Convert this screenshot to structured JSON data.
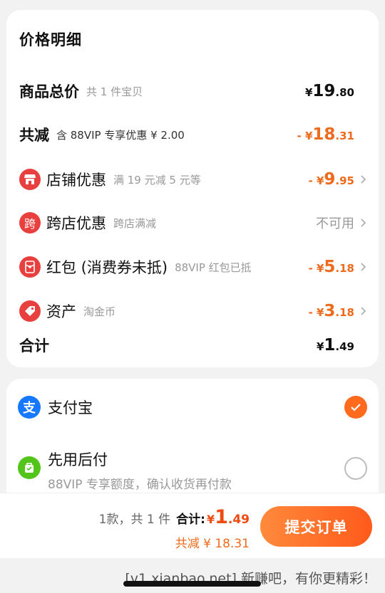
{
  "price_detail": {
    "title": "价格明细",
    "goods_total": {
      "label": "商品总价",
      "sub": "共 1 件宝贝",
      "currency": "¥",
      "int": "19",
      "dec": ".80"
    },
    "total_discount": {
      "label": "共减",
      "sub": "含 88VIP 专享优惠 ¥ 2.00",
      "prefix": "- ¥",
      "int": "18",
      "dec": ".31"
    },
    "shop_discount": {
      "icon": "shop-icon",
      "label": "店铺优惠",
      "sub": "满 19 元减 5 元等",
      "prefix": "- ¥",
      "int": "9",
      "dec": ".95"
    },
    "cross_shop": {
      "icon_text": "跨",
      "label": "跨店优惠",
      "sub": "跨店满减",
      "value": "不可用"
    },
    "red_packet": {
      "icon": "red-packet-icon",
      "label": "红包 (消费券未抵)",
      "sub": "88VIP 红包已抵",
      "prefix": "- ¥",
      "int": "5",
      "dec": ".18"
    },
    "assets": {
      "icon": "tag-icon",
      "label": "资产",
      "sub": "淘金币",
      "prefix": "- ¥",
      "int": "3",
      "dec": ".18"
    },
    "sum": {
      "label": "合计",
      "currency": "¥",
      "int": "1",
      "dec": ".49"
    }
  },
  "payment": {
    "alipay": {
      "icon": "alipay-icon",
      "icon_text": "支",
      "name": "支付宝",
      "selected": true
    },
    "pay_later": {
      "icon": "pay-later-icon",
      "name": "先用后付",
      "sub": "88VIP 专享额度，确认收货再付款",
      "selected": false
    }
  },
  "bottom_bar": {
    "count_text": "1款，共 1 件",
    "total_label": "合计:",
    "total_currency": "¥",
    "total_int": "1",
    "total_dec": ".49",
    "saved_text": "共减 ¥ 18.31",
    "submit_label": "提交订单"
  },
  "watermark": "[v1.xianbao.net] 新赚吧，有你更精彩！",
  "colors": {
    "accent": "#ee6a1d",
    "button": "#ff6a1d",
    "icon_red": "#e8403f",
    "alipay_blue": "#1677ff",
    "pay_later_green": "#52c41a"
  }
}
